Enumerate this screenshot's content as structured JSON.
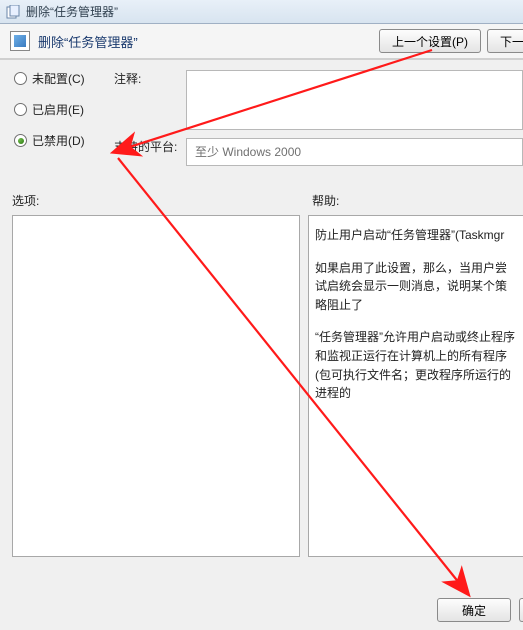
{
  "window": {
    "title": "删除“任务管理器”"
  },
  "header": {
    "title": "删除“任务管理器”"
  },
  "nav": {
    "prev": "上一个设置(P)",
    "next": "下一个"
  },
  "radios": {
    "not_configured": "未配置(C)",
    "enabled": "已启用(E)",
    "disabled": "已禁用(D)",
    "selected": "disabled"
  },
  "meta": {
    "comment_label": "注释:",
    "platform_label": "支持的平台:",
    "platform_value": "至少 Windows 2000"
  },
  "labels": {
    "options": "选项:",
    "help": "帮助:"
  },
  "help": {
    "p1": "防止用户启动“任务管理器”(Taskmgr",
    "p2": "如果启用了此设置，那么，当用户尝试启统会显示一则消息，说明某个策略阻止了",
    "p3": "“任务管理器”允许用户启动或终止程序和监视正运行在计算机上的所有程序(包可执行文件名；更改程序所运行的进程的"
  },
  "footer": {
    "ok": "确定"
  }
}
